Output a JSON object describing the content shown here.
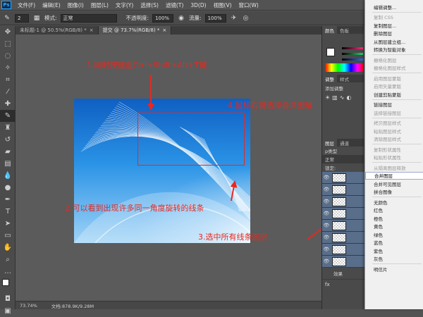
{
  "menubar": {
    "logo": "Ps",
    "items": [
      "文件(F)",
      "编辑(E)",
      "图像(I)",
      "图层(L)",
      "文字(Y)",
      "选择(S)",
      "滤镜(T)",
      "3D(D)",
      "视图(V)",
      "窗口(W)"
    ]
  },
  "options": {
    "brush_size": "2",
    "mode_label": "模式:",
    "mode_value": "正常",
    "opacity_label": "不透明度:",
    "opacity_value": "100%",
    "flow_label": "流量:",
    "flow_value": "100%"
  },
  "tabs": [
    {
      "label": "未标题-1 @ 50.5%(RGB/8) *",
      "close": "×"
    },
    {
      "label": "提交 @ 73.7%(RGB/8) *",
      "close": "×"
    }
  ],
  "status": {
    "zoom": "73.74%",
    "doc_size": "文档:878.9K/9.28M"
  },
  "right_panel": {
    "color_tabs": [
      "颜色",
      "色板"
    ],
    "adjust_tabs": [
      "调整",
      "样式"
    ],
    "adjust_title": "添加调整",
    "layer_tabs": [
      "图层",
      "通道"
    ],
    "kind_label": "p类型",
    "blend_label": "正常",
    "lock_label": "锁定:",
    "effects_label": "效果",
    "fx_label": "fx"
  },
  "context_menu": {
    "items": [
      {
        "label": "编辑调整...",
        "disabled": false
      },
      {
        "label": "复制 CSS",
        "disabled": true
      },
      {
        "label": "复制图层...",
        "disabled": false
      },
      {
        "label": "删除图层",
        "disabled": false
      },
      {
        "label": "从图层建立组...",
        "disabled": false
      },
      {
        "label": "转换为智能对象",
        "disabled": false
      },
      {
        "label": "栅格化图层",
        "disabled": true
      },
      {
        "label": "栅格化图层样式",
        "disabled": true
      },
      {
        "label": "启用图层蒙版",
        "disabled": true
      },
      {
        "label": "启用矢量蒙版",
        "disabled": true
      },
      {
        "label": "创建剪贴蒙版",
        "disabled": false
      },
      {
        "label": "链接图层",
        "disabled": false
      },
      {
        "label": "选择链接图层",
        "disabled": true
      },
      {
        "label": "拷贝图层样式",
        "disabled": true
      },
      {
        "label": "粘贴图层样式",
        "disabled": true
      },
      {
        "label": "清除图层样式",
        "disabled": true
      },
      {
        "label": "复制形状属性",
        "disabled": true
      },
      {
        "label": "粘贴形状属性",
        "disabled": true
      },
      {
        "label": "从隔离图层释放",
        "disabled": true
      },
      {
        "label": "合并图层",
        "disabled": false,
        "highlight": true
      },
      {
        "label": "合并可见图层",
        "disabled": false
      },
      {
        "label": "拼合图像",
        "disabled": false
      },
      {
        "label": "无颜色",
        "disabled": false
      },
      {
        "label": "红色",
        "disabled": false
      },
      {
        "label": "橙色",
        "disabled": false
      },
      {
        "label": "黄色",
        "disabled": false
      },
      {
        "label": "绿色",
        "disabled": false
      },
      {
        "label": "蓝色",
        "disabled": false
      },
      {
        "label": "紫色",
        "disabled": false
      },
      {
        "label": "灰色",
        "disabled": false
      },
      {
        "label": "明信片",
        "disabled": false
      }
    ]
  },
  "annotations": {
    "step1": "1.同时按键盘Ctrl+Shift+Alt+T键",
    "step2": "2.可以看到出现许多同一角度旋转的线条",
    "step3": "3.选中所有线条图层",
    "step4": "4.鼠标右键选择合并图层"
  },
  "colors": {
    "annotation_red": "#e8281f",
    "ps_gray": "#535353",
    "image_blue": "#1a7fd6"
  }
}
